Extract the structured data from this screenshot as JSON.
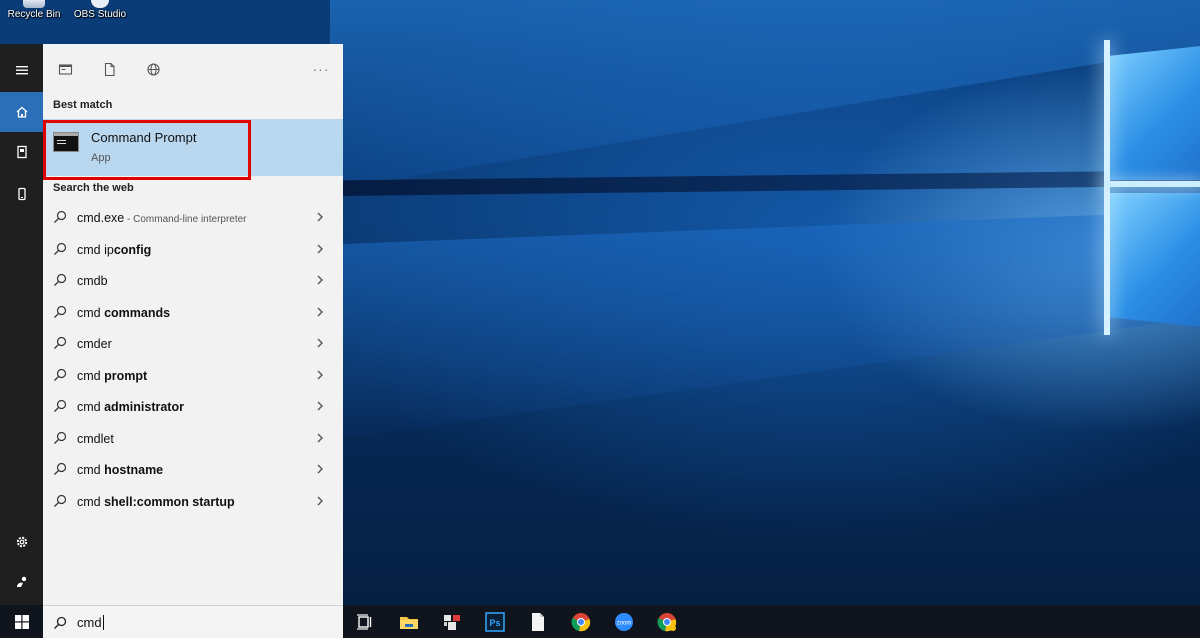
{
  "desktop": {
    "icons": [
      {
        "label": "Recycle Bin",
        "icon": "recycle-bin-icon"
      },
      {
        "label": "OBS Studio",
        "icon": "obs-studio-icon"
      }
    ]
  },
  "start_rail": {
    "items": [
      {
        "icon": "hamburger-menu-icon"
      },
      {
        "icon": "home-icon",
        "active": true
      },
      {
        "icon": "documents-icon"
      },
      {
        "icon": "phone-icon"
      },
      {
        "icon": "settings-gear-icon"
      },
      {
        "icon": "user-account-icon"
      }
    ]
  },
  "search_panel": {
    "filter_tabs": [
      {
        "icon": "apps-icon"
      },
      {
        "icon": "documents-icon"
      },
      {
        "icon": "web-globe-icon"
      }
    ],
    "more_label": "···",
    "best_match": {
      "heading": "Best match",
      "title": "Command Prompt",
      "subtitle": "App",
      "icon": "command-prompt-icon"
    },
    "web": {
      "heading": "Search the web",
      "results": [
        {
          "prefix": "cmd.exe",
          "bold": "",
          "desc": " - Command-line interpreter"
        },
        {
          "prefix": "cmd ip",
          "bold": "config",
          "desc": ""
        },
        {
          "prefix": "cmdb",
          "bold": "",
          "desc": ""
        },
        {
          "prefix": "cmd ",
          "bold": "commands",
          "desc": ""
        },
        {
          "prefix": "cmder",
          "bold": "",
          "desc": ""
        },
        {
          "prefix": "cmd ",
          "bold": "prompt",
          "desc": ""
        },
        {
          "prefix": "cmd ",
          "bold": "administrator",
          "desc": ""
        },
        {
          "prefix": "cmdlet",
          "bold": "",
          "desc": ""
        },
        {
          "prefix": "cmd ",
          "bold": "hostname",
          "desc": ""
        },
        {
          "prefix": "cmd ",
          "bold": "shell:common startup",
          "desc": ""
        }
      ]
    }
  },
  "search_box": {
    "value": "cmd"
  },
  "taskbar": {
    "pinned": [
      {
        "icon": "task-view-icon"
      },
      {
        "icon": "file-explorer-icon"
      },
      {
        "icon": "app-icon"
      },
      {
        "icon": "photoshop-icon",
        "label": "Ps"
      },
      {
        "icon": "document-icon"
      },
      {
        "icon": "chrome-icon"
      },
      {
        "icon": "zoom-icon",
        "label": "zoom"
      },
      {
        "icon": "chrome-icon"
      }
    ]
  },
  "colors": {
    "accent": "#2b6fb8",
    "highlight": "#b9d7ef",
    "annotation_red": "#e00000"
  }
}
